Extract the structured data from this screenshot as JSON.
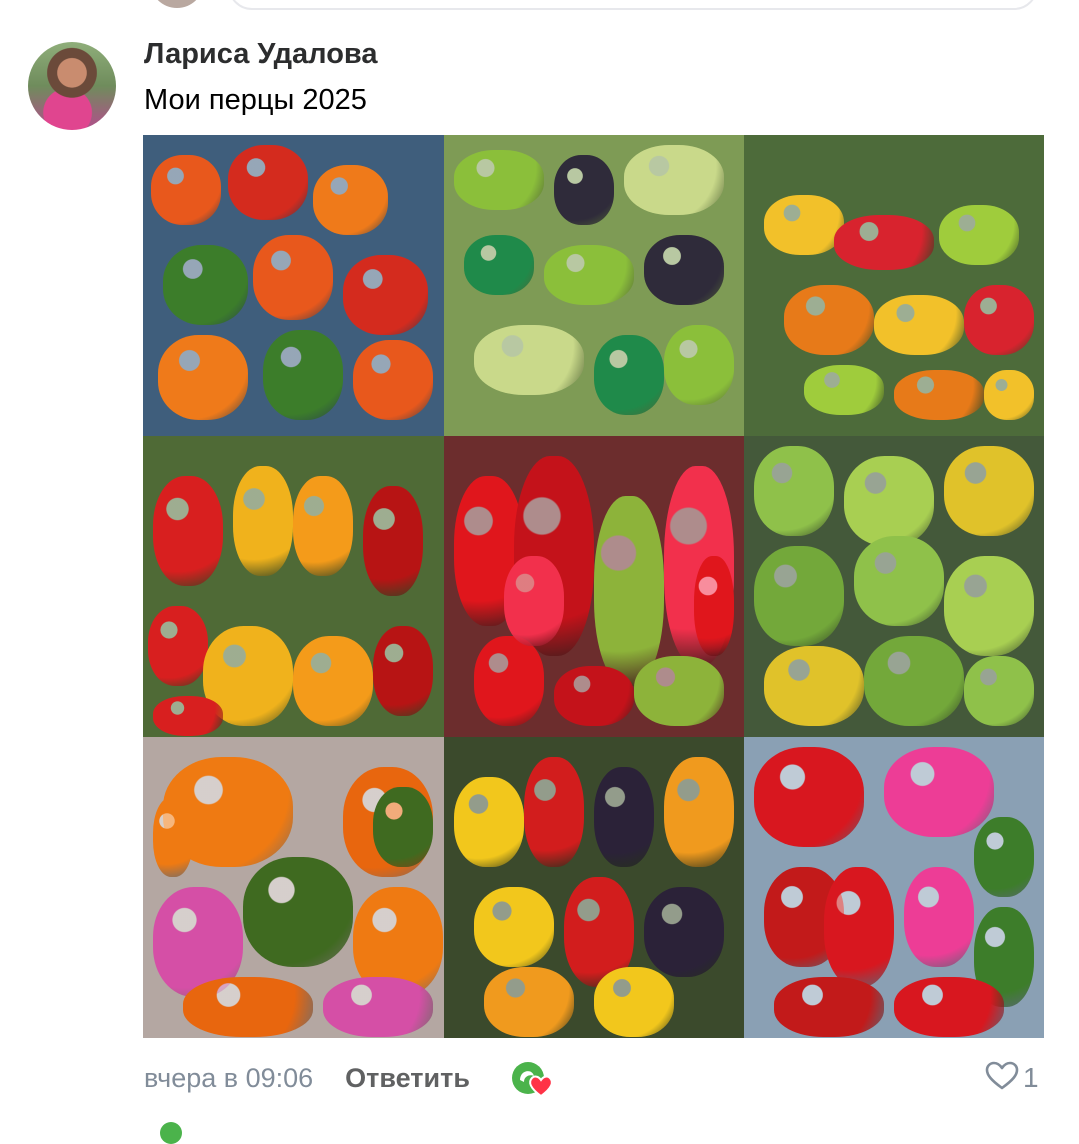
{
  "comment": {
    "author": "Лариса Удалова",
    "text": "Мои перцы 2025",
    "timestamp": "вчера в 09:06",
    "reply_label": "Ответить",
    "like_count": "1",
    "avatar_icon": "user-avatar-photo",
    "reaction_icon": "reaction-heart-icon",
    "like_icon": "heart-outline-icon"
  },
  "photos": [
    {
      "label": "photo-1",
      "bg": "#3f5e7c",
      "colors": [
        "#e8581c",
        "#d42b1e",
        "#ef7a1a",
        "#3c7d2a"
      ]
    },
    {
      "label": "photo-2",
      "bg": "#7e9b55",
      "colors": [
        "#8bbf3a",
        "#2f2b3a",
        "#c9d98a",
        "#1f8a4a"
      ]
    },
    {
      "label": "photo-3",
      "bg": "#4d6b3a",
      "colors": [
        "#f2c12a",
        "#d8232e",
        "#9fcc3c",
        "#e77a19"
      ]
    },
    {
      "label": "photo-4",
      "bg": "#4f6a36",
      "colors": [
        "#d81f1f",
        "#f0b21c",
        "#f49b1a",
        "#b71414"
      ]
    },
    {
      "label": "photo-5",
      "bg": "#6c2d2d",
      "colors": [
        "#e0161c",
        "#c4121a",
        "#8db33a",
        "#f2304c"
      ]
    },
    {
      "label": "photo-6",
      "bg": "#44593a",
      "colors": [
        "#8fc14a",
        "#a8cf52",
        "#e0c22a",
        "#73a83a"
      ]
    },
    {
      "label": "photo-7",
      "bg": "#b4a7a2",
      "colors": [
        "#ef7a12",
        "#e8660e",
        "#d54fa6",
        "#3f6a20"
      ]
    },
    {
      "label": "photo-8",
      "bg": "#3b4a2c",
      "colors": [
        "#f2c71c",
        "#d21d1d",
        "#2b2238",
        "#f09a1e"
      ]
    },
    {
      "label": "photo-9",
      "bg": "#8aa0b4",
      "colors": [
        "#d8171f",
        "#ed3d96",
        "#3d7d2a",
        "#c21a1a"
      ]
    }
  ],
  "colors": {
    "secondary_text": "#818c99",
    "primary_text": "#2c2d2e",
    "accent_green": "#4bb34b",
    "heart_red": "#ff3347"
  }
}
